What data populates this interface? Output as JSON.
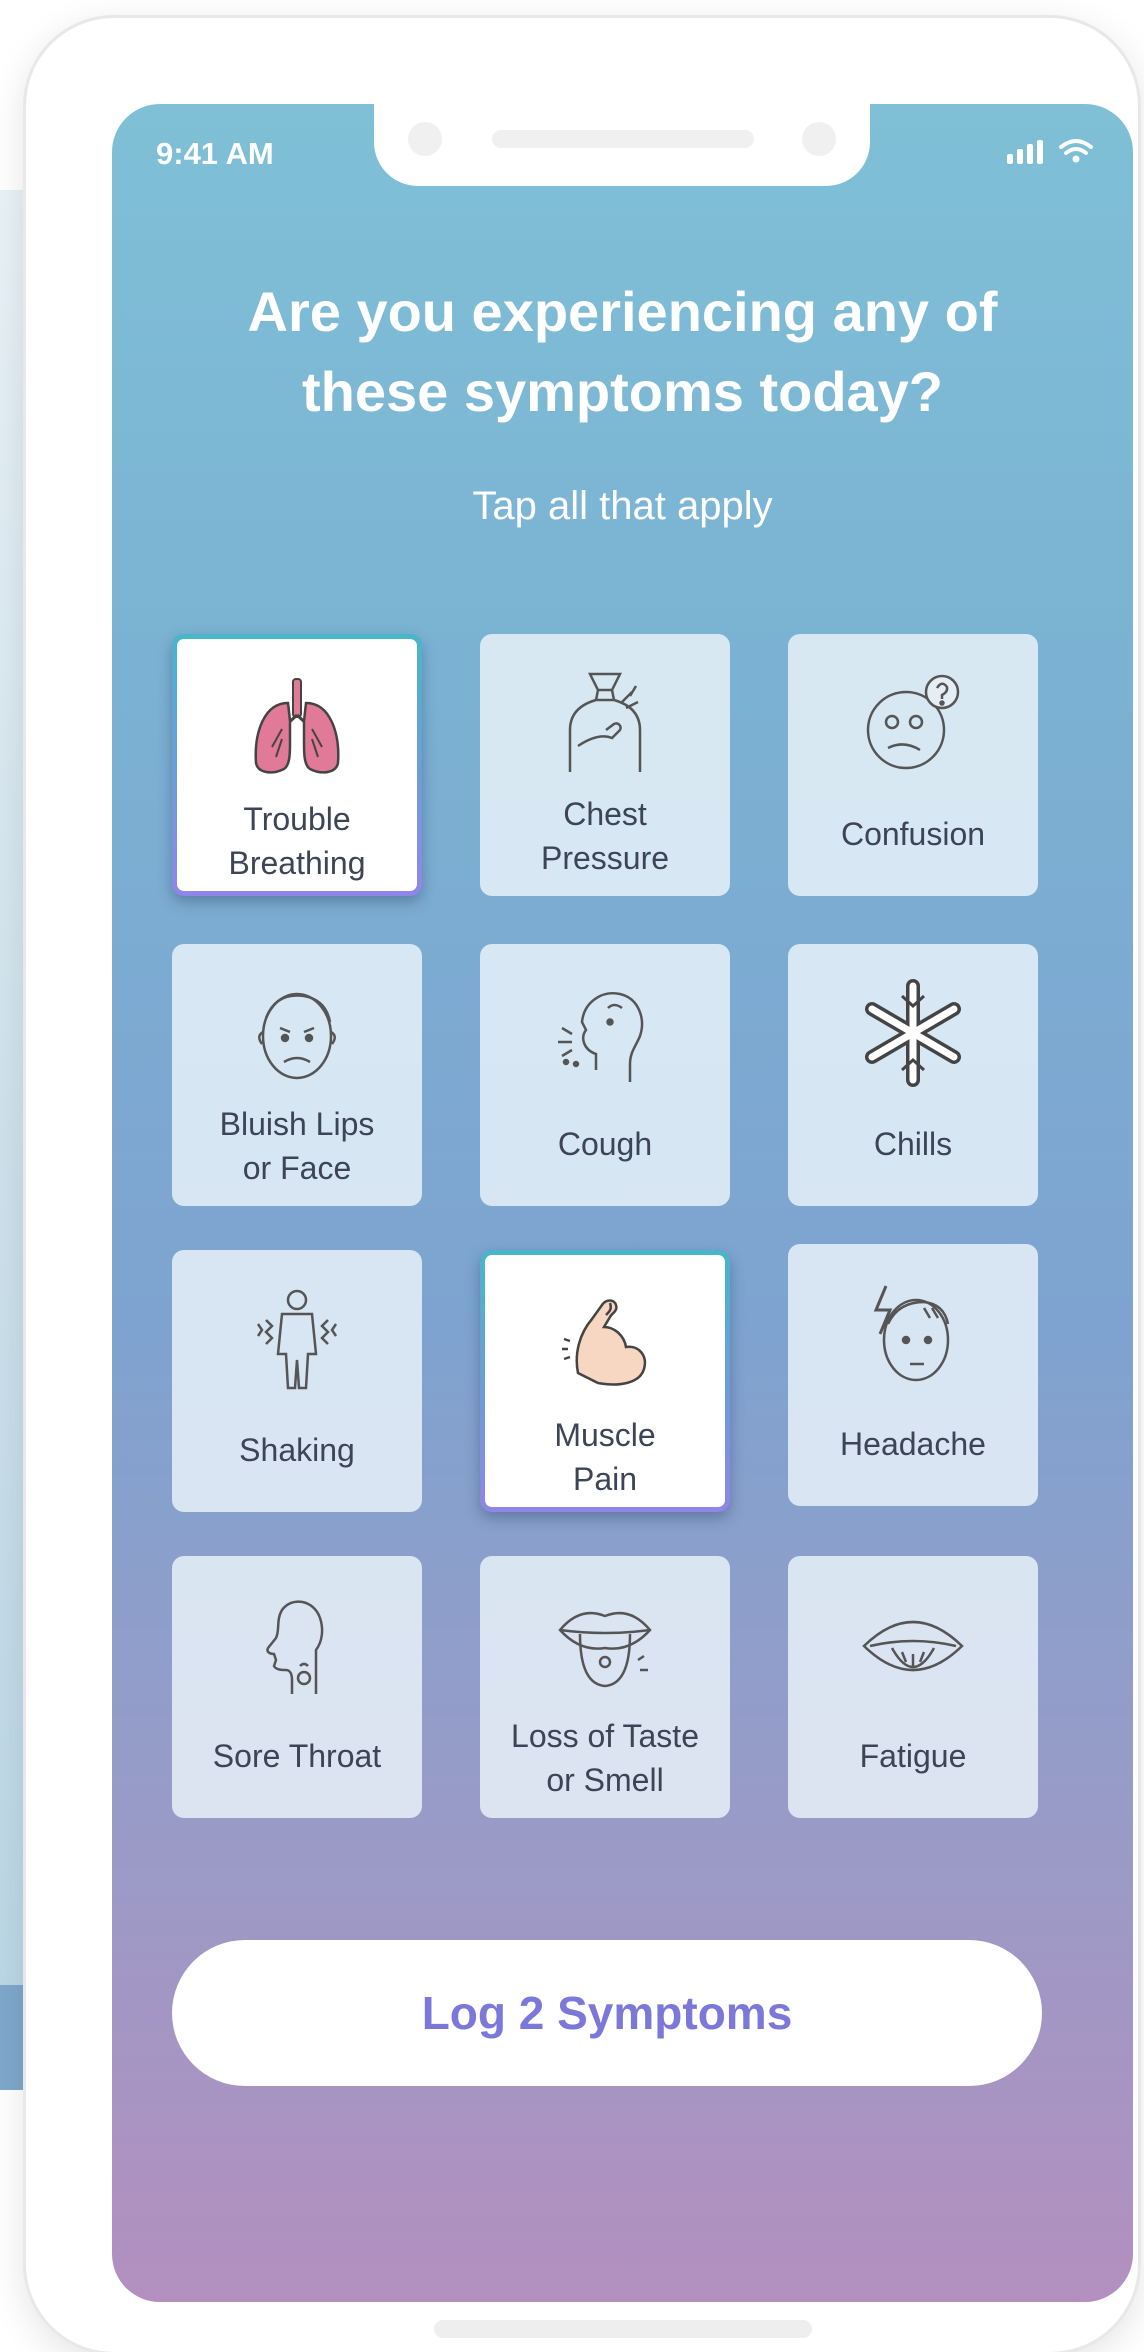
{
  "status_bar": {
    "time": "9:41 AM",
    "signal_icon": "signal-bars-icon",
    "wifi_icon": "wifi-icon"
  },
  "header": {
    "title_line1": "Are you experiencing any of",
    "title_line2": "these symptoms today?",
    "subtitle": "Tap all that apply"
  },
  "symptoms": [
    {
      "line1": "Trouble",
      "line2": "Breathing",
      "icon": "lungs-icon",
      "selected": true
    },
    {
      "line1": "Chest",
      "line2": "Pressure",
      "icon": "chest-pressure-icon",
      "selected": false
    },
    {
      "line1": "Confusion",
      "line2": "",
      "icon": "confused-face-icon",
      "selected": false
    },
    {
      "line1": "Bluish Lips",
      "line2": "or Face",
      "icon": "sad-face-icon",
      "selected": false
    },
    {
      "line1": "Cough",
      "line2": "",
      "icon": "cough-icon",
      "selected": false
    },
    {
      "line1": "Chills",
      "line2": "",
      "icon": "snowflake-icon",
      "selected": false
    },
    {
      "line1": "Shaking",
      "line2": "",
      "icon": "shaking-person-icon",
      "selected": false
    },
    {
      "line1": "Muscle",
      "line2": "Pain",
      "icon": "flexed-arm-icon",
      "selected": true
    },
    {
      "line1": "Headache",
      "line2": "",
      "icon": "headache-icon",
      "selected": false
    },
    {
      "line1": "Sore Throat",
      "line2": "",
      "icon": "sore-throat-icon",
      "selected": false
    },
    {
      "line1": "Loss of Taste",
      "line2": "or Smell",
      "icon": "tongue-icon",
      "selected": false
    },
    {
      "line1": "Fatigue",
      "line2": "",
      "icon": "tired-eye-icon",
      "selected": false
    }
  ],
  "log_button": {
    "label": "Log 2 Symptoms"
  },
  "colors": {
    "gradient_top": "#7fc0d6",
    "gradient_bottom": "#b38fbf",
    "accent": "#7b78d9",
    "selected_border_top": "#48b6c9",
    "selected_border_bottom": "#8f86e8",
    "text": "#3c4455"
  }
}
